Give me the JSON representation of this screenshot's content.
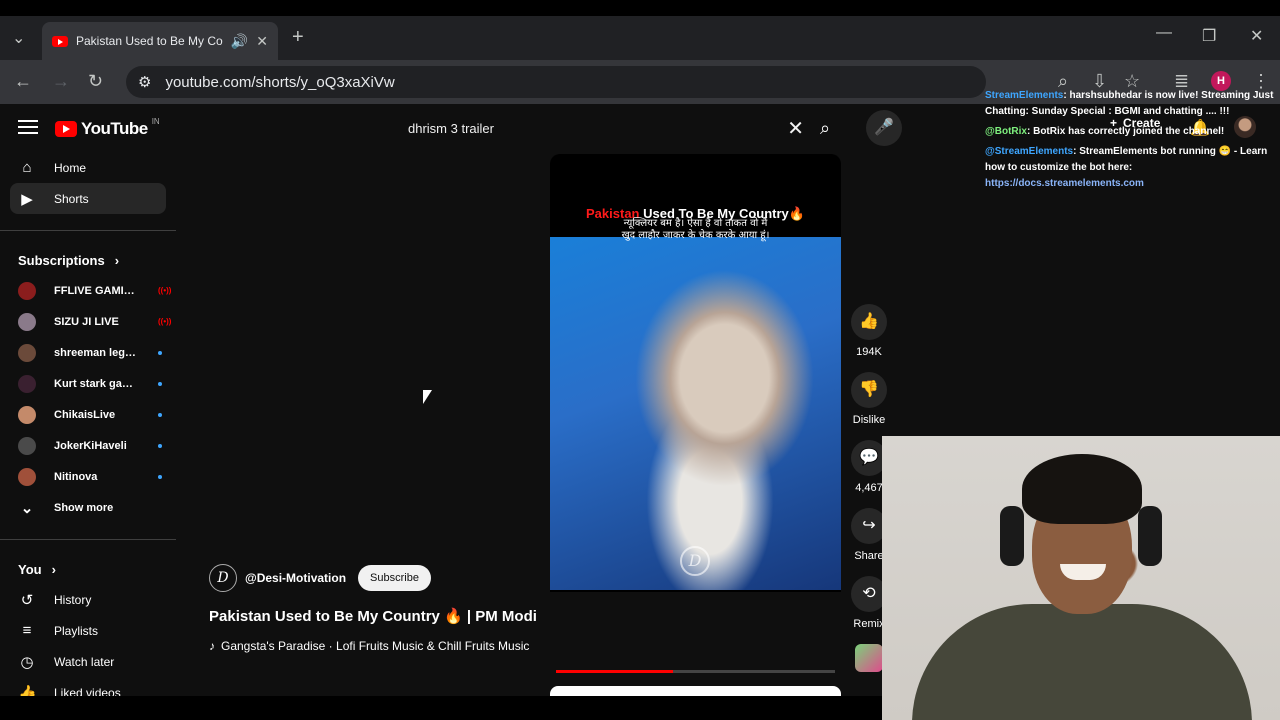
{
  "browser": {
    "tab_title": "Pakistan Used to Be My Country",
    "url": "youtube.com/shorts/y_oQ3xaXiVw",
    "profile_initial": "H"
  },
  "youtube": {
    "region": "IN",
    "search_query": "dhrism 3 trailer",
    "nav": [
      {
        "label": "Home",
        "icon": "home-icon"
      },
      {
        "label": "Shorts",
        "icon": "shorts-icon"
      }
    ],
    "subscriptions_title": "Subscriptions",
    "subscriptions": [
      {
        "name": "FFLIVE GAMING ...",
        "status": "live"
      },
      {
        "name": "SIZU JI LIVE",
        "status": "live"
      },
      {
        "name": "shreeman legen...",
        "status": "new"
      },
      {
        "name": "Kurt stark gaming",
        "status": "new"
      },
      {
        "name": "ChikaisLive",
        "status": "new"
      },
      {
        "name": "JokerKiHaveli",
        "status": "new"
      },
      {
        "name": "Nitinova",
        "status": "new"
      }
    ],
    "show_more": "Show more",
    "you_title": "You",
    "you_items": [
      {
        "label": "History",
        "icon": "history-icon"
      },
      {
        "label": "Playlists",
        "icon": "playlists-icon"
      },
      {
        "label": "Watch later",
        "icon": "watch-later-icon"
      },
      {
        "label": "Liked videos",
        "icon": "liked-videos-icon"
      }
    ],
    "create_label": "Create"
  },
  "short": {
    "caption_red": "Pakistan",
    "caption_white": "Used To Be My Country",
    "hindi_line1": "न्यूक्लियर बम है। ऐसा है वो ताकत वो मैं",
    "hindi_line2": "खुद लाहौर जाकर के चेक करके आया हूं।",
    "channel": "@Desi-Motivation",
    "subscribe_label": "Subscribe",
    "title": "Pakistan Used to Be My Country 🔥 | PM Modi",
    "music": "Gangsta's Paradise · Lofi Fruits Music & Chill Fruits Music",
    "progress": 0.42,
    "actions": {
      "likes": "194K",
      "dislike": "Dislike",
      "comments": "4,467",
      "share": "Share",
      "remix": "Remix"
    }
  },
  "chat": {
    "m1_user": "StreamElements",
    "m1_text": ": harshsubhedar is now live! Streaming Just Chatting: Sunday Special : BGMI and chatting .... !!!",
    "m2_user": "@BotRix",
    "m2_text": ": BotRix has correctly joined the channel!",
    "m3_user": "@StreamElements",
    "m3_text": ": StreamElements bot running 😁 - Learn how to customize the bot here:",
    "m3_link": "https://docs.streamelements.com"
  }
}
